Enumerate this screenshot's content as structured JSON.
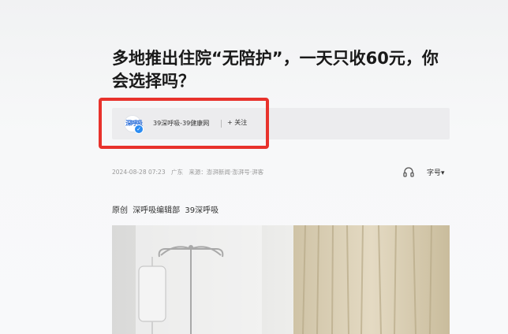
{
  "article": {
    "title": "多地推出住院“无陪护”，一天只收60元，你会选择吗？",
    "author": {
      "avatar_text": "深呼吸",
      "name": "39深呼吸-39健康网",
      "follow_label": "+ 关注"
    },
    "meta": {
      "date": "2024-08-28 07:23",
      "region": "广东",
      "source": "来源：澎湃新闻·澎湃号·湃客"
    },
    "font_size_label": "字号▾",
    "byline": {
      "tag": "原创",
      "department": "深呼吸编辑部",
      "account": "39深呼吸"
    }
  },
  "icons": {
    "listen": "headphone-icon",
    "verified": "verified-badge-icon"
  },
  "colors": {
    "highlight": "#e8322c",
    "verified": "#2b8cf2"
  }
}
